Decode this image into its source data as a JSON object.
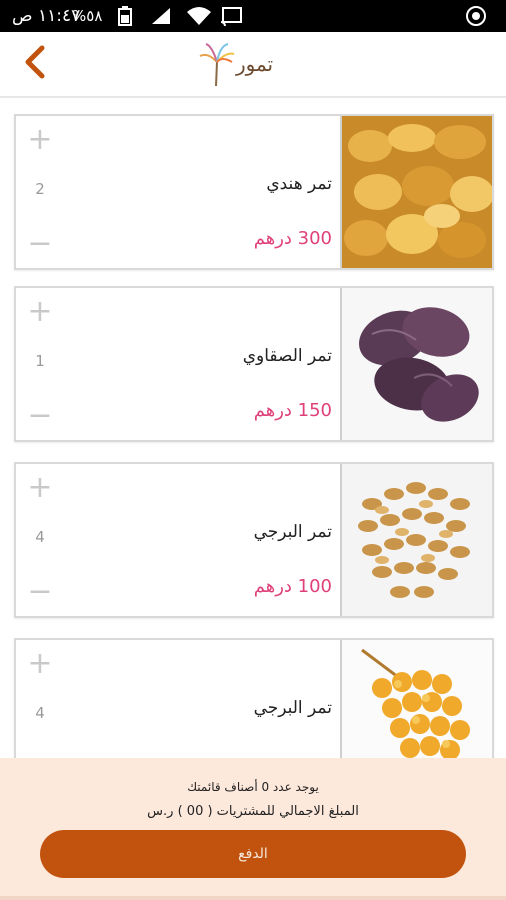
{
  "status": {
    "time": "١١:٤٧ ص",
    "battery": "%٥٨",
    "icons": [
      "camera-shutter-icon",
      "cast-icon",
      "wifi-icon",
      "signal-icon",
      "battery-icon"
    ]
  },
  "appbar": {
    "logo_text": "تمور",
    "back_icon": "chevron-left-icon",
    "accent": "#c2530e"
  },
  "products": [
    {
      "name": "تمر هندي",
      "price": "300 درهم",
      "qty": "2",
      "image": "golden-dates-photo"
    },
    {
      "name": "تمر الصقاوي",
      "price": "150 درهم",
      "qty": "1",
      "image": "dark-dates-photo"
    },
    {
      "name": "تمر البرجي",
      "price": "100 درهم",
      "qty": "4",
      "image": "light-dates-photo"
    },
    {
      "name": "تمر البرجي",
      "price": "",
      "qty": "4",
      "image": "yellow-dates-cluster-photo"
    }
  ],
  "footer": {
    "line1": "يوجد عدد 0 أصناف قائمتك",
    "line2": "المبلغ الاجمالي للمشتريات ( 00 )  ر.س",
    "pay_label": "الدفع"
  },
  "colors": {
    "price": "#e0407a",
    "footer_bg": "#fde8dc",
    "button": "#c2530e"
  }
}
